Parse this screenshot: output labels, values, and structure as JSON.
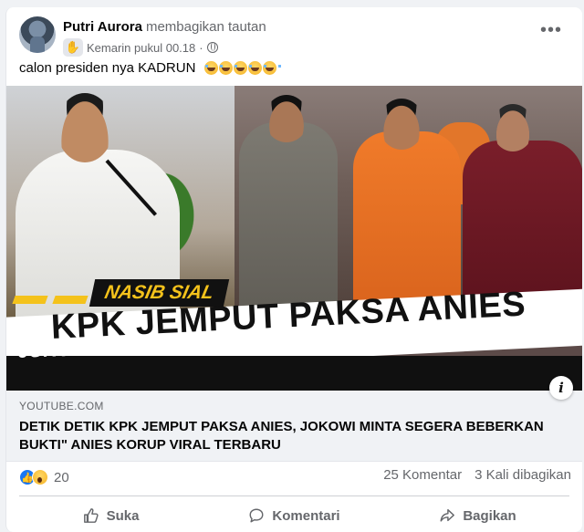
{
  "post": {
    "author": "Putri Aurora",
    "action": "membagikan tautan",
    "timestamp": "Kemarin pukul 00.18",
    "caption": "calon presiden nya KADRUN",
    "more_label": "•••",
    "caption_emoji": "rolling-laughing-emoji",
    "caption_emoji_count": 5
  },
  "media": {
    "tag": "NASIB SIAL",
    "headline": "KPK JEMPUT PAKSA ANIES",
    "subline": "JOKOWI MINTA SEGERA BEBERKAN BUKTI\" ANIES KORUP",
    "info_label": "i"
  },
  "link": {
    "domain": "YOUTUBE.COM",
    "title": "DETIK DETIK KPK JEMPUT PAKSA ANIES, JOKOWI MINTA SEGERA BEBERKAN BUKTI\" ANIES KORUP VIRAL TERBARU"
  },
  "stats": {
    "reaction_count": "20",
    "comments": "25 Komentar",
    "shares": "3 Kali dibagikan"
  },
  "actions": {
    "like": "Suka",
    "comment": "Komentari",
    "share": "Bagikan"
  },
  "colors": {
    "brand_blue": "#1877f2",
    "tag_yellow": "#f4c21b",
    "muted_text": "#65676b"
  }
}
